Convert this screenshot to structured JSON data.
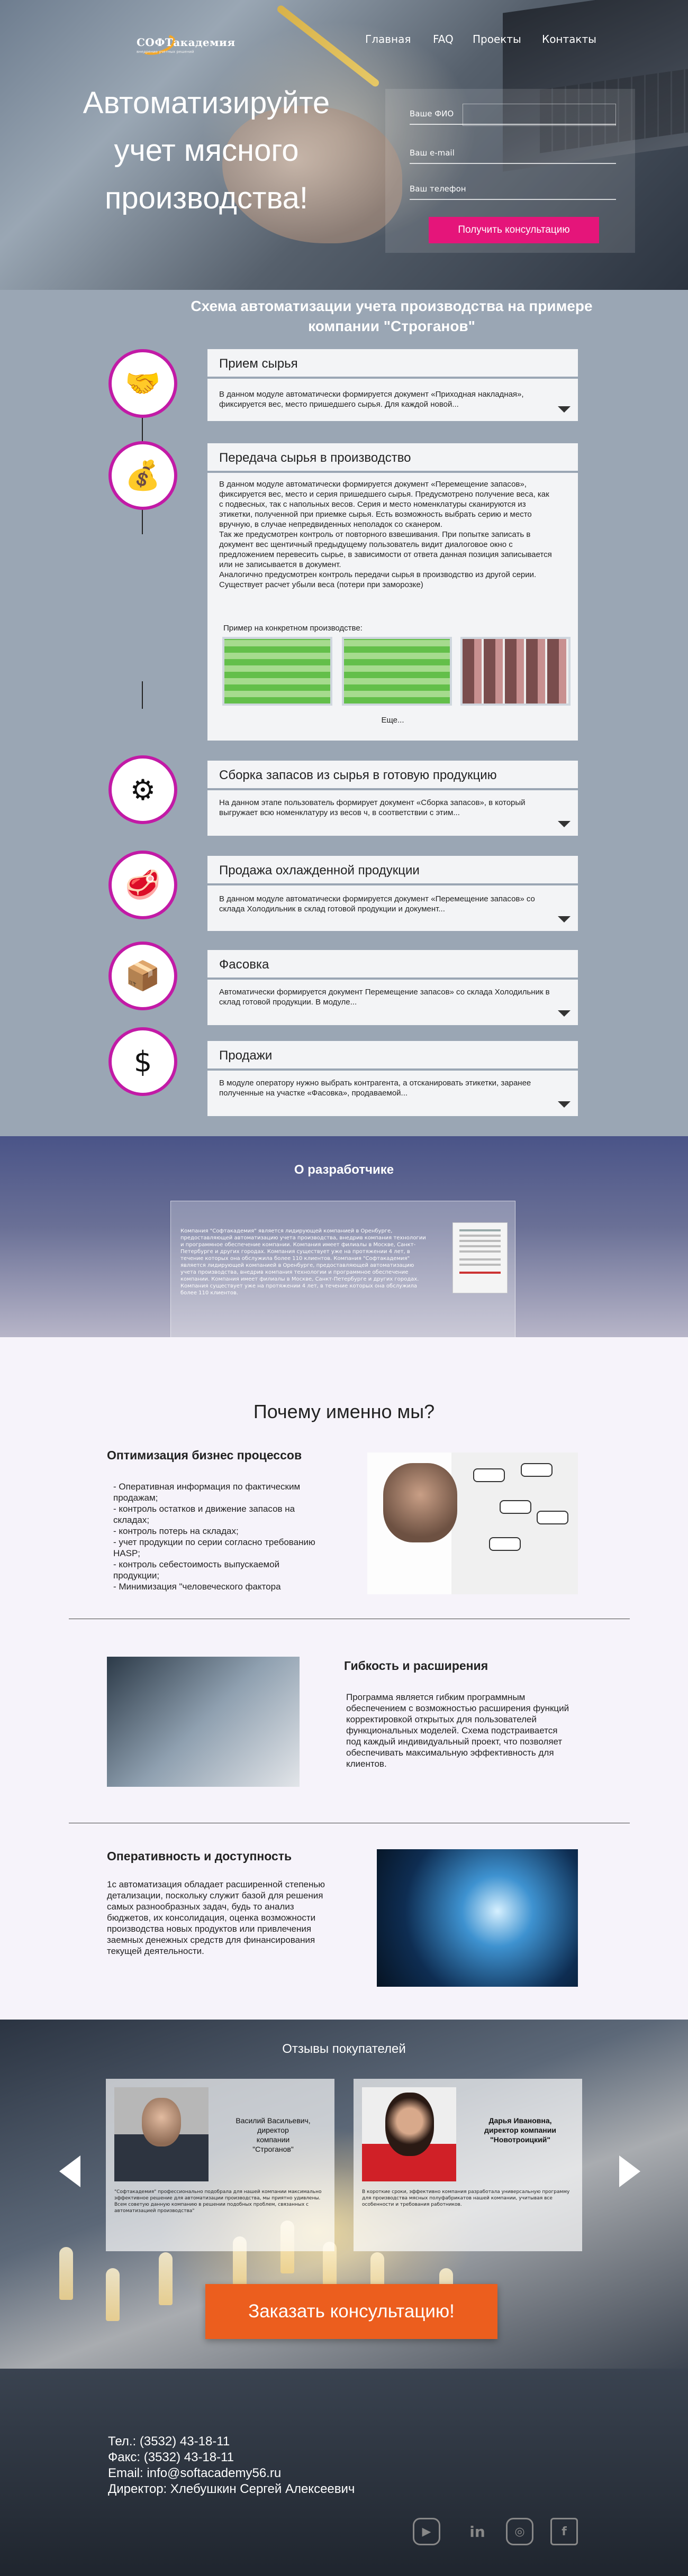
{
  "header": {
    "logo_text": "СОФТакадемия",
    "logo_sub": "внедрение учетных решений",
    "nav": [
      "Главная",
      "FAQ",
      "Проекты",
      "Контакты"
    ]
  },
  "hero": {
    "title_lines": [
      "Автоматизируйте",
      "учет мясного",
      "производства!"
    ],
    "form": {
      "name_label": "Ваше ФИО",
      "email_label": "Ваш e-mail",
      "phone_label": "Ваш телефон",
      "submit": "Получить консультацию"
    }
  },
  "scheme": {
    "title": "Схема автоматизации учета производства на примере компании \"Строганов\"",
    "steps": [
      {
        "title": "Прием сырья",
        "text": "В данном модуле автоматически формируется документ «Приходная накладная», фиксируется вес, место пришедшего сырья. Для каждой новой..."
      },
      {
        "title": "Передача сырья в производство",
        "text": "В данном модуле автоматически формируется документ «Перемещение запасов», фиксируется вес, место и серия пришедшего сырья. Предусмотрено получение веса, как с подвесных, так с напольных весов. Серия и место номенклатуры сканируются из этикетки, полученной при приемке сырья. Есть возможность выбрать серию и место вручную, в случае непредвиденных неполадок со сканером.\nТак же предусмотрен контроль от повторного взвешивания. При попытке записать в документ вес щентичный предыдущему пользователь видит диалоговое окно с предложением перевесить сырье, в зависимости от ответа данная позиция записывается или не записывается в документ.\nАналогично предусмотрен контроль передачи сырья в производство из другой серии. Существует расчет убыли веса (потери при заморозке)",
        "example": "Пример на конкретном производстве:",
        "more": "Еще..."
      },
      {
        "title": "Сборка запасов из сырья в готовую продукцию",
        "text": "На данном этапе пользователь формирует документ «Сборка запасов», в который выгружает всю номенклатуру из весов ч, в соответствии с этим..."
      },
      {
        "title": "Продажа охлажденной продукции",
        "text": "В данном модуле автоматически формируется документ «Перемещение запасов» со склада Холодильник в склад готовой продукции и документ..."
      },
      {
        "title": "Фасовка",
        "text": "Автоматически формируется документ Перемещение запасов» со склада Холодильник в склад готовой продукции. В модуле..."
      },
      {
        "title": "Продажи",
        "text": "В модуле оператору нужно выбрать контрагента, а отсканировать этикетки, заранее полученные на участке «Фасовка», продаваемой..."
      }
    ],
    "icons": [
      "handshake-icon",
      "money-bag-icon",
      "conveyor-icon",
      "meat-icon",
      "packing-icon",
      "dollar-icon"
    ]
  },
  "developer": {
    "title": "О разработчике",
    "text": "Компания \"Софтакадемия\" является лидирующей компанией в Оренбурге, предоставляющей автоматизацию учета производства, внедрив компания технологии и программное обеспечение компании. Компания имеет филиалы в Москве, Санкт-Петербурге и других городах. Компания существует уже на протяжении 4 лет, в течение которых она обслужила более 110 клиентов. Компания \"Софтакадемия\" является лидирующей компанией в Оренбурге, предоставляющей автоматизацию учета производства, внедрив компания технологии и программное обеспечение компании. Компания имеет филиалы в Москве, Санкт-Петербурге и других городах. Компания существует уже на протяжении 4 лет, в течение которых она обслужила более 110 клиентов."
  },
  "why": {
    "title": "Почему именно мы?",
    "b1_title": "Оптимизация бизнес процессов",
    "b1_text": "- Оперативная информация по фактическим продажам;\n- контроль остатков и движение запасов на складах;\n- контроль потерь на складах;\n- учет продукции по серии согласно требованию HASP;\n- контроль себестоимость выпускаемой продукции;\n- Минимизация \"человеческого фактора",
    "b2_title": "Гибкость и расширения",
    "b2_text": "Программа  является гибким программным обеспечением с возможностью расширения функций корректировкой открытых для пользователей функциональных моделей. Схема подстраивается под каждый индивидуальный проект, что позволяет обеспечивать максимальную эффективность для клиентов.",
    "b3_title": "Оперативность и доступность",
    "b3_text": "1с автоматизация обладает расширенной степенью детализации, поскольку служит базой для решения самых разнообразных задач, будь то анализ бюджетов, их консолидация, оценка возможности производства новых продуктов или привлечения заемных денежных средств для финансирования текущей деятельности."
  },
  "reviews": {
    "title": "Отзывы покупателей",
    "r1_name": "Василий Васильевич,\nдиректор\nкомпании\n\"Строганов\"",
    "r1_text": "\"Софтакадемия\" профессионально подобрала для нашей компании максимально эффективное решение для автоматизации производства, мы приятно удивлены. Всем советую данную компанию в решении подобных проблем, связанных с автоматизацией производства\"",
    "r2_name": "Дарья Ивановна,\nдиректор компании\n\"Новотроицкий\"",
    "r2_text": "В короткие сроки, эффективно компания разработала универсальную программу для производства мясных полуфабрикатов нашей компании, учитывая все особенности и требования работников.",
    "cta": "Заказать консультацию!"
  },
  "footer": {
    "phone": "Тел.: (3532) 43-18-11",
    "fax": "Факс: (3532) 43-18-11",
    "email": "Email: info@softacademy56.ru",
    "director": "Директор: Хлебушкин Сергей Алексеевич",
    "social": [
      "youtube-icon",
      "linkedin-icon",
      "instagram-icon",
      "facebook-icon"
    ]
  }
}
